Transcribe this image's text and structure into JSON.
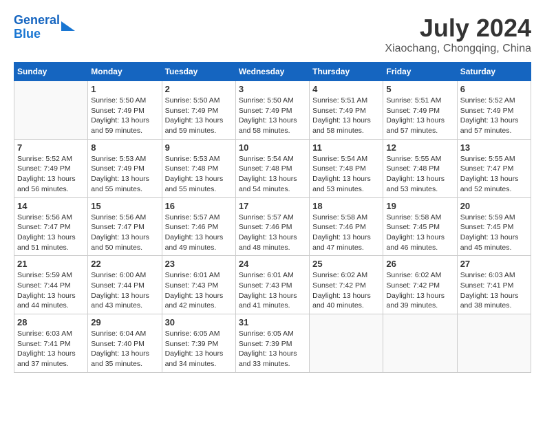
{
  "header": {
    "logo_line1": "General",
    "logo_line2": "Blue",
    "title": "July 2024",
    "subtitle": "Xiaochang, Chongqing, China"
  },
  "days_of_week": [
    "Sunday",
    "Monday",
    "Tuesday",
    "Wednesday",
    "Thursday",
    "Friday",
    "Saturday"
  ],
  "weeks": [
    [
      {
        "num": "",
        "info": ""
      },
      {
        "num": "1",
        "info": "Sunrise: 5:50 AM\nSunset: 7:49 PM\nDaylight: 13 hours\nand 59 minutes."
      },
      {
        "num": "2",
        "info": "Sunrise: 5:50 AM\nSunset: 7:49 PM\nDaylight: 13 hours\nand 59 minutes."
      },
      {
        "num": "3",
        "info": "Sunrise: 5:50 AM\nSunset: 7:49 PM\nDaylight: 13 hours\nand 58 minutes."
      },
      {
        "num": "4",
        "info": "Sunrise: 5:51 AM\nSunset: 7:49 PM\nDaylight: 13 hours\nand 58 minutes."
      },
      {
        "num": "5",
        "info": "Sunrise: 5:51 AM\nSunset: 7:49 PM\nDaylight: 13 hours\nand 57 minutes."
      },
      {
        "num": "6",
        "info": "Sunrise: 5:52 AM\nSunset: 7:49 PM\nDaylight: 13 hours\nand 57 minutes."
      }
    ],
    [
      {
        "num": "7",
        "info": "Sunrise: 5:52 AM\nSunset: 7:49 PM\nDaylight: 13 hours\nand 56 minutes."
      },
      {
        "num": "8",
        "info": "Sunrise: 5:53 AM\nSunset: 7:49 PM\nDaylight: 13 hours\nand 55 minutes."
      },
      {
        "num": "9",
        "info": "Sunrise: 5:53 AM\nSunset: 7:48 PM\nDaylight: 13 hours\nand 55 minutes."
      },
      {
        "num": "10",
        "info": "Sunrise: 5:54 AM\nSunset: 7:48 PM\nDaylight: 13 hours\nand 54 minutes."
      },
      {
        "num": "11",
        "info": "Sunrise: 5:54 AM\nSunset: 7:48 PM\nDaylight: 13 hours\nand 53 minutes."
      },
      {
        "num": "12",
        "info": "Sunrise: 5:55 AM\nSunset: 7:48 PM\nDaylight: 13 hours\nand 53 minutes."
      },
      {
        "num": "13",
        "info": "Sunrise: 5:55 AM\nSunset: 7:47 PM\nDaylight: 13 hours\nand 52 minutes."
      }
    ],
    [
      {
        "num": "14",
        "info": "Sunrise: 5:56 AM\nSunset: 7:47 PM\nDaylight: 13 hours\nand 51 minutes."
      },
      {
        "num": "15",
        "info": "Sunrise: 5:56 AM\nSunset: 7:47 PM\nDaylight: 13 hours\nand 50 minutes."
      },
      {
        "num": "16",
        "info": "Sunrise: 5:57 AM\nSunset: 7:46 PM\nDaylight: 13 hours\nand 49 minutes."
      },
      {
        "num": "17",
        "info": "Sunrise: 5:57 AM\nSunset: 7:46 PM\nDaylight: 13 hours\nand 48 minutes."
      },
      {
        "num": "18",
        "info": "Sunrise: 5:58 AM\nSunset: 7:46 PM\nDaylight: 13 hours\nand 47 minutes."
      },
      {
        "num": "19",
        "info": "Sunrise: 5:58 AM\nSunset: 7:45 PM\nDaylight: 13 hours\nand 46 minutes."
      },
      {
        "num": "20",
        "info": "Sunrise: 5:59 AM\nSunset: 7:45 PM\nDaylight: 13 hours\nand 45 minutes."
      }
    ],
    [
      {
        "num": "21",
        "info": "Sunrise: 5:59 AM\nSunset: 7:44 PM\nDaylight: 13 hours\nand 44 minutes."
      },
      {
        "num": "22",
        "info": "Sunrise: 6:00 AM\nSunset: 7:44 PM\nDaylight: 13 hours\nand 43 minutes."
      },
      {
        "num": "23",
        "info": "Sunrise: 6:01 AM\nSunset: 7:43 PM\nDaylight: 13 hours\nand 42 minutes."
      },
      {
        "num": "24",
        "info": "Sunrise: 6:01 AM\nSunset: 7:43 PM\nDaylight: 13 hours\nand 41 minutes."
      },
      {
        "num": "25",
        "info": "Sunrise: 6:02 AM\nSunset: 7:42 PM\nDaylight: 13 hours\nand 40 minutes."
      },
      {
        "num": "26",
        "info": "Sunrise: 6:02 AM\nSunset: 7:42 PM\nDaylight: 13 hours\nand 39 minutes."
      },
      {
        "num": "27",
        "info": "Sunrise: 6:03 AM\nSunset: 7:41 PM\nDaylight: 13 hours\nand 38 minutes."
      }
    ],
    [
      {
        "num": "28",
        "info": "Sunrise: 6:03 AM\nSunset: 7:41 PM\nDaylight: 13 hours\nand 37 minutes."
      },
      {
        "num": "29",
        "info": "Sunrise: 6:04 AM\nSunset: 7:40 PM\nDaylight: 13 hours\nand 35 minutes."
      },
      {
        "num": "30",
        "info": "Sunrise: 6:05 AM\nSunset: 7:39 PM\nDaylight: 13 hours\nand 34 minutes."
      },
      {
        "num": "31",
        "info": "Sunrise: 6:05 AM\nSunset: 7:39 PM\nDaylight: 13 hours\nand 33 minutes."
      },
      {
        "num": "",
        "info": ""
      },
      {
        "num": "",
        "info": ""
      },
      {
        "num": "",
        "info": ""
      }
    ]
  ]
}
